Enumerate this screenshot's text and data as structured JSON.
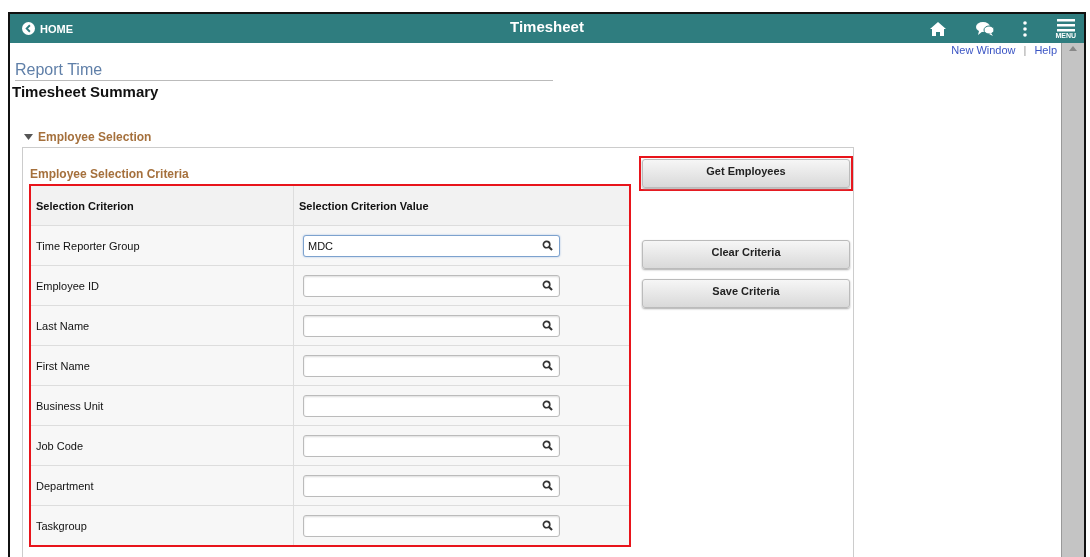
{
  "header": {
    "back": "HOME",
    "title": "Timesheet",
    "menu_label": "MENU"
  },
  "links": [
    "New Window",
    "|",
    "Help"
  ],
  "breadcrumb": "Report Time",
  "page_title": "Timesheet Summary",
  "section": {
    "title": "Employee Selection",
    "expanded": true
  },
  "group_title": "Employee Selection Criteria",
  "table": {
    "columns": [
      "Selection Criterion",
      "Selection Criterion Value"
    ],
    "rows": [
      {
        "label": "Time Reporter Group",
        "value": "MDC",
        "focused": true
      },
      {
        "label": "Employee ID",
        "focused": false
      },
      {
        "label": "Last Name",
        "focused": false
      },
      {
        "label": "First Name",
        "focused": false
      },
      {
        "label": "Business Unit",
        "focused": false
      },
      {
        "label": "Job Code",
        "focused": false
      },
      {
        "label": "Department",
        "focused": false
      },
      {
        "label": "Taskgroup",
        "focused": false
      }
    ]
  },
  "buttons": [
    {
      "label": "Get Employees",
      "highlighted": true
    },
    {
      "label": "Clear Criteria",
      "highlighted": false
    },
    {
      "label": "Save Criteria",
      "highlighted": false
    }
  ]
}
